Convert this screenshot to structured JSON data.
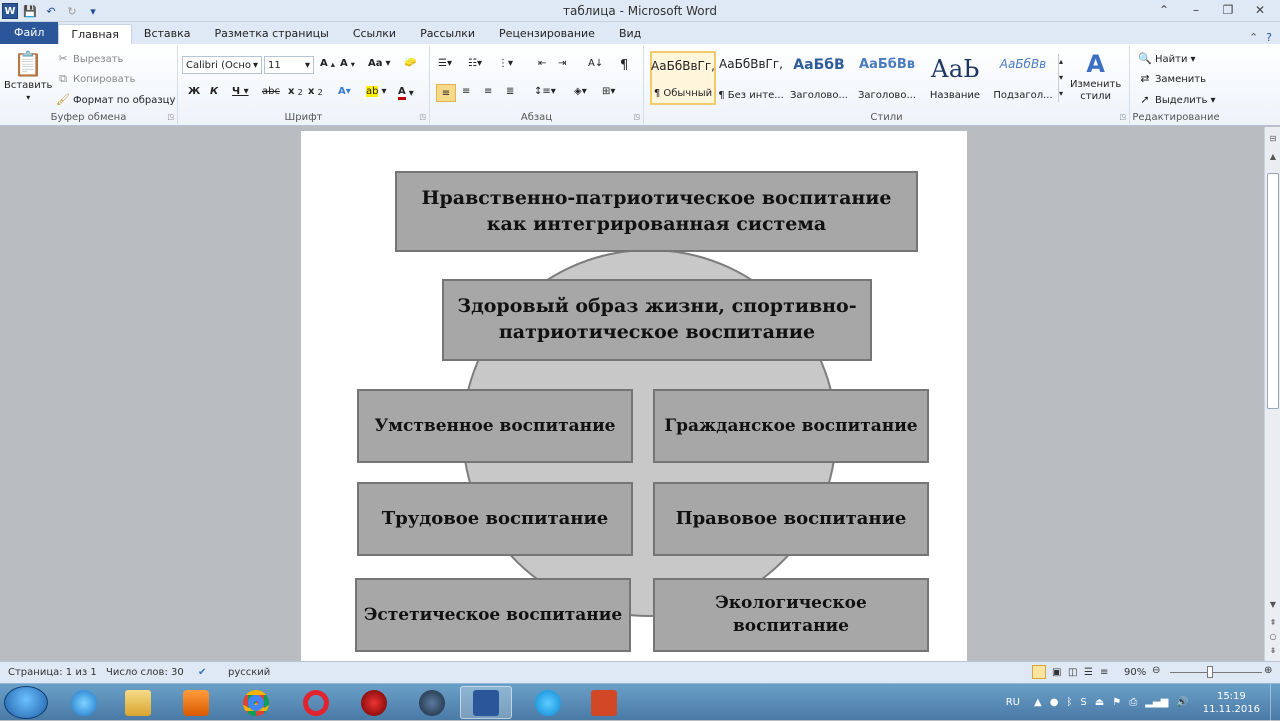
{
  "window": {
    "title": "таблица - Microsoft Word",
    "minimize": "–",
    "restore": "❐",
    "close": "✕"
  },
  "tabs": [
    "Файл",
    "Главная",
    "Вставка",
    "Разметка страницы",
    "Ссылки",
    "Рассылки",
    "Рецензирование",
    "Вид"
  ],
  "ribbon": {
    "clipboard": {
      "label": "Буфер обмена",
      "paste": "Вставить",
      "cut": "Вырезать",
      "copy": "Копировать",
      "format_painter": "Формат по образцу"
    },
    "font": {
      "label": "Шрифт",
      "font_name": "Calibri (Осно",
      "font_size": "11"
    },
    "paragraph": {
      "label": "Абзац"
    },
    "styles": {
      "label": "Стили",
      "items": [
        {
          "preview": "АаБбВвГг,",
          "name": "¶ Обычный"
        },
        {
          "preview": "АаБбВвГг,",
          "name": "¶ Без инте..."
        },
        {
          "preview": "АаБбВ",
          "name": "Заголово..."
        },
        {
          "preview": "АаБбВв",
          "name": "Заголово..."
        },
        {
          "preview": "АаЬ",
          "name": "Название"
        },
        {
          "preview": "АаБбВв",
          "name": "Подзагол..."
        }
      ],
      "change_styles_line1": "Изменить",
      "change_styles_line2": "стили"
    },
    "editing": {
      "label": "Редактирование",
      "find": "Найти",
      "replace": "Заменить",
      "select": "Выделить"
    }
  },
  "diagram": {
    "title_line1": "Нравственно-патриотическое воспитание",
    "title_line2": "как интегрированная система",
    "health_line1": "Здоровый образ жизни, спортивно-",
    "health_line2": "патриотическое воспитание",
    "boxes": [
      "Умственное воспитание",
      "Гражданское воспитание",
      "Трудовое воспитание",
      "Правовое воспитание",
      "Эстетическое воспитание",
      "Экологическое воспитание"
    ]
  },
  "status": {
    "page": "Страница: 1 из 1",
    "words": "Число слов: 30",
    "language": "русский",
    "zoom": "90%"
  },
  "taskbar": {
    "lang": "RU",
    "time": "15:19",
    "date": "11.11.2016"
  }
}
